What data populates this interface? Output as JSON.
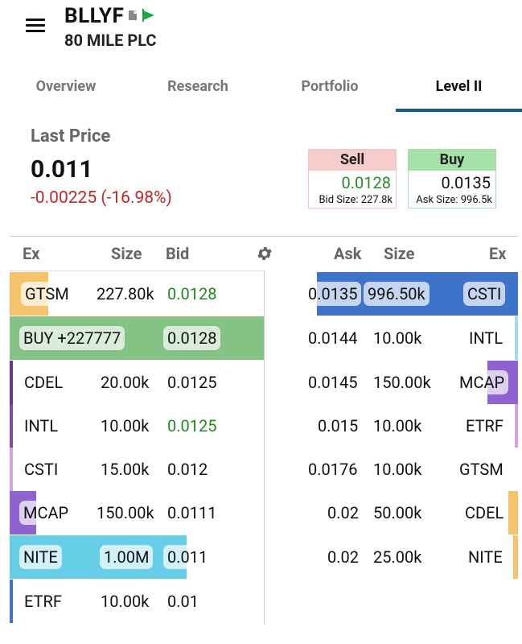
{
  "header": {
    "menu_icon": "hamburger-icon",
    "symbol": "BLLYF",
    "company": "80 MILE PLC",
    "doc_icon": "document-icon",
    "flag_icon": "green-flag-icon"
  },
  "tabs": [
    {
      "label": "Overview",
      "active": false
    },
    {
      "label": "Research",
      "active": false
    },
    {
      "label": "Portfolio",
      "active": false
    },
    {
      "label": "Level II",
      "active": true
    }
  ],
  "last_price": {
    "label": "Last Price",
    "value": "0.011",
    "change": "-0.00225 (-16.98%)"
  },
  "sell": {
    "label": "Sell",
    "price": "0.0128",
    "size": "Bid Size: 227.8k"
  },
  "buy": {
    "label": "Buy",
    "price": "0.0135",
    "size": "Ask Size: 996.5k"
  },
  "columns": {
    "ex": "Ex",
    "size": "Size",
    "bid": "Bid",
    "ask": "Ask",
    "ask_size": "Size",
    "ask_ex": "Ex",
    "settings_icon": "gear-icon"
  },
  "bids": [
    {
      "ex": "GTSM",
      "size": "227.80k",
      "price": "0.0128",
      "price_color": "#1e8a1e",
      "bar": "#f5c36b"
    },
    {
      "ex": "BUY +227777",
      "size": "",
      "price": "0.0128",
      "price_color": "#111111",
      "bar": "#84c384"
    },
    {
      "ex": "CDEL",
      "size": "20.00k",
      "price": "0.0125",
      "price_color": "#111111",
      "bar": "#6a3a8e"
    },
    {
      "ex": "INTL",
      "size": "10.00k",
      "price": "0.0125",
      "price_color": "#1e8a1e",
      "bar": "#7c4a9e"
    },
    {
      "ex": "CSTI",
      "size": "15.00k",
      "price": "0.012",
      "price_color": "#111111",
      "bar": "#d6a3d9"
    },
    {
      "ex": "MCAP",
      "size": "150.00k",
      "price": "0.0111",
      "price_color": "#111111",
      "bar": "#8e63d0"
    },
    {
      "ex": "NITE",
      "size": "1.00M",
      "price": "0.011",
      "price_color": "#111111",
      "bar": "#66cee6"
    },
    {
      "ex": "ETRF",
      "size": "10.00k",
      "price": "0.01",
      "price_color": "#111111",
      "bar": "#3d73c9"
    }
  ],
  "asks": [
    {
      "price": "0.0135",
      "size": "996.50k",
      "ex": "CSTI",
      "bar": "#3d73c9"
    },
    {
      "price": "0.0144",
      "size": "10.00k",
      "ex": "INTL",
      "bar": "#9fd9ea"
    },
    {
      "price": "0.0145",
      "size": "150.00k",
      "ex": "MCAP",
      "bar": "#8e63d0"
    },
    {
      "price": "0.015",
      "size": "10.00k",
      "ex": "ETRF",
      "bar": "#d6a3d9"
    },
    {
      "price": "0.0176",
      "size": "10.00k",
      "ex": "GTSM",
      "bar": "#ffffff"
    },
    {
      "price": "0.02",
      "size": "50.00k",
      "ex": "CDEL",
      "bar": "#f5c36b"
    },
    {
      "price": "0.02",
      "size": "25.00k",
      "ex": "NITE",
      "bar": "#f5c36b"
    }
  ]
}
